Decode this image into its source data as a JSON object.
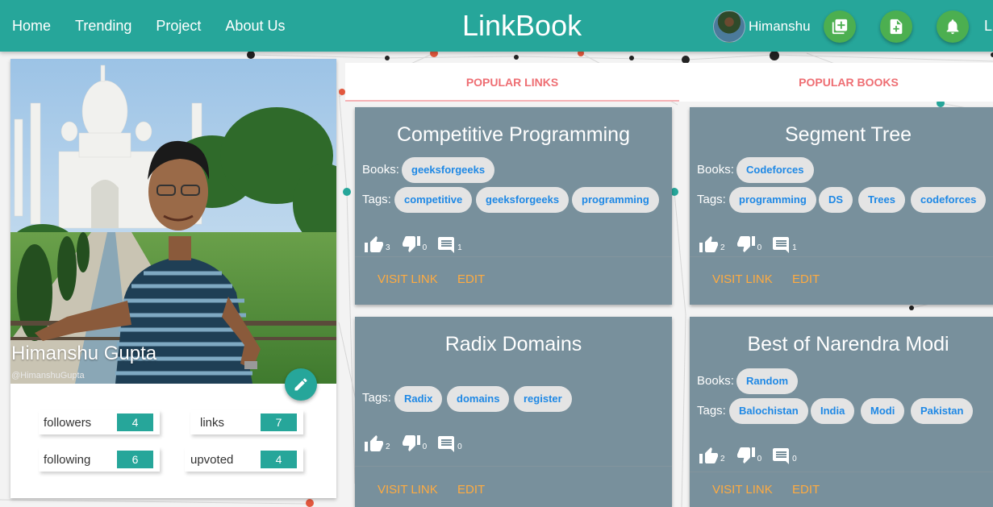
{
  "nav": {
    "links": [
      "Home",
      "Trending",
      "Project",
      "About Us"
    ],
    "brand": "LinkBook",
    "user_name": "Himanshu",
    "truncated": "L"
  },
  "profile": {
    "name": "Himanshu Gupta",
    "handle": "@HimanshuGupta",
    "stats": {
      "followers": {
        "label": "followers",
        "value": "4"
      },
      "links": {
        "label": "links",
        "value": "7"
      },
      "following": {
        "label": "following",
        "value": "6"
      },
      "upvoted": {
        "label": "upvoted",
        "value": "4"
      }
    }
  },
  "tabs": [
    "POPULAR LINKS",
    "POPULAR BOOKS"
  ],
  "labels": {
    "books": "Books:",
    "tags": "Tags:",
    "visit": "VISIT LINK",
    "edit": "EDIT"
  },
  "cards": [
    {
      "title": "Competitive Programming",
      "books": [
        "geeksforgeeks"
      ],
      "tags": [
        "competitive",
        "geeksforgeeks",
        "programming"
      ],
      "upvotes": "3",
      "downvotes": "0",
      "comments": "1"
    },
    {
      "title": "Segment Tree",
      "books": [
        "Codeforces"
      ],
      "tags": [
        "programming",
        "DS",
        "Trees",
        "codeforces"
      ],
      "upvotes": "2",
      "downvotes": "0",
      "comments": "1"
    },
    {
      "title": "Radix Domains",
      "books": [],
      "tags": [
        "Radix",
        "domains",
        "register"
      ],
      "upvotes": "2",
      "downvotes": "0",
      "comments": "0"
    },
    {
      "title": "Best of Narendra Modi",
      "books": [
        "Random"
      ],
      "tags": [
        "Balochistan",
        "India",
        "Modi",
        "Pakistan"
      ],
      "upvotes": "2",
      "downvotes": "0",
      "comments": "0"
    }
  ],
  "colors": {
    "primary": "#26a69a",
    "card": "#78909c",
    "accent": "#ffab40",
    "tab": "#ee6e73",
    "fab": "#4caf50"
  }
}
